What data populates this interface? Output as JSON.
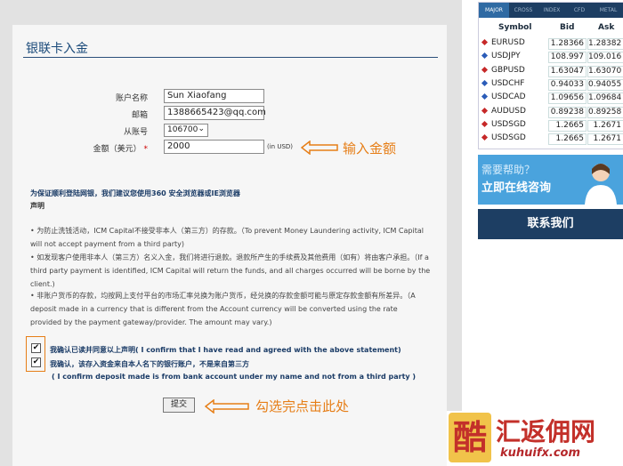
{
  "page": {
    "title": "银联卡入金"
  },
  "form": {
    "account_name_label": "账户名称",
    "account_name_value": "Sun Xiaofang",
    "email_label": "邮箱",
    "email_value": "1388665423@qq.com",
    "from_account_label": "从账号",
    "from_account_value": "106700",
    "amount_label": "金额（美元）",
    "required_mark": "*",
    "amount_value": "2000",
    "amount_unit": "(in USD)"
  },
  "annotations": {
    "amount_hint": "输入金额",
    "submit_hint": "勾选完点击此处"
  },
  "notice": {
    "title": "为保证顺利登陆网银，我们建议您使用360 安全浏览器或IE浏览器",
    "subtitle": "声明",
    "bullets": [
      "• 为防止洗钱活动，ICM Capital不接受非本人（第三方）的存款。（To prevent Money Laundering activity, ICM Capital will not accept payment from a third party)",
      "• 如发现客户使用非本人（第三方）名义入金，我们将进行退款。退款所产生的手续费及其他费用（如有）将由客户承担。（If a third party payment is identified, ICM Capital will return the funds, and all charges occurred will be borne by the client.)",
      "• 非账户货币的存款，均按网上支付平台的市场汇率兑换为账户货币，经兑换的存款金额可能与原定存款金额有所差异。（A deposit made in a currency that is different from the Account currency will be converted using the rate provided by the payment gateway/provider. The amount may vary.)"
    ]
  },
  "confirm": {
    "check1_label": "我确认已读并同意以上声明( I confirm that I have read and agreed with the above statement)",
    "check2_label": "我确认，该存入资金来自本人名下的银行账户，不是来自第三方",
    "check2_sub": "( I confirm deposit made is from bank account under my name and not from a third party )",
    "check1_checked": true,
    "check2_checked": true,
    "check_mark": "✔"
  },
  "submit": {
    "label": "提交"
  },
  "rates": {
    "tabs": [
      "MAJOR",
      "CROSS",
      "INDEX",
      "CFD",
      "METAL"
    ],
    "active_tab": "MAJOR",
    "headers": {
      "symbol": "Symbol",
      "bid": "Bid",
      "ask": "Ask"
    },
    "rows": [
      {
        "symbol": "EURUSD",
        "bid": "1.28366",
        "ask": "1.28382",
        "direction": "down"
      },
      {
        "symbol": "USDJPY",
        "bid": "108.997",
        "ask": "109.016",
        "direction": "up"
      },
      {
        "symbol": "GBPUSD",
        "bid": "1.63047",
        "ask": "1.63070",
        "direction": "down"
      },
      {
        "symbol": "USDCHF",
        "bid": "0.94033",
        "ask": "0.94055",
        "direction": "up"
      },
      {
        "symbol": "USDCAD",
        "bid": "1.09656",
        "ask": "1.09684",
        "direction": "up"
      },
      {
        "symbol": "AUDUSD",
        "bid": "0.89238",
        "ask": "0.89258",
        "direction": "down"
      },
      {
        "symbol": "USDSGD",
        "bid": "1.2665",
        "ask": "1.2671",
        "direction": "down"
      },
      {
        "symbol": "USDSGD",
        "bid": "1.2665",
        "ask": "1.2671",
        "direction": "down"
      }
    ],
    "colors": {
      "up": "#2b5cb8",
      "down": "#c62828"
    }
  },
  "help": {
    "line1": "需要帮助？",
    "line2": "立即在线咨询"
  },
  "contact": {
    "label": "联系我们"
  },
  "watermark": {
    "cn": "汇返佣网",
    "en": "kuhuifx.com",
    "seal": "酷"
  }
}
